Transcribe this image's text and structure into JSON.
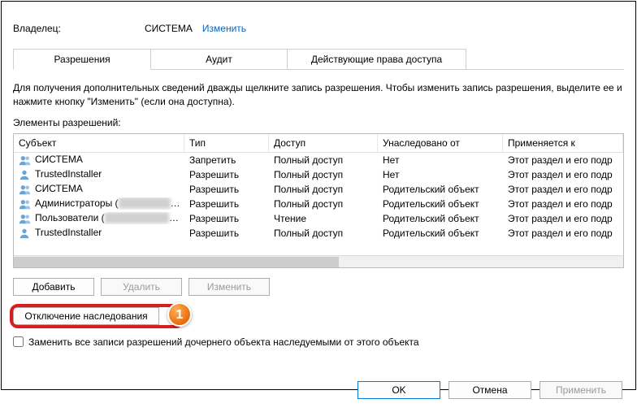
{
  "owner": {
    "label": "Владелец:",
    "value": "СИСТЕМА",
    "change_link": "Изменить"
  },
  "tabs": {
    "permissions": "Разрешения",
    "audit": "Аудит",
    "effective": "Действующие права доступа"
  },
  "info_text": "Для получения дополнительных сведений дважды щелкните запись разрешения. Чтобы изменить запись разрешения, выделите ее и нажмите кнопку \"Изменить\" (если она доступна).",
  "elements_label": "Элементы разрешений:",
  "columns": {
    "subject": "Субъект",
    "type": "Тип",
    "access": "Доступ",
    "inherited": "Унаследовано от",
    "applies": "Применяется к"
  },
  "rows": [
    {
      "icon": "users",
      "subject": "СИСТЕМА",
      "type": "Запретить",
      "access": "Полный доступ",
      "inherited": "Нет",
      "applies": "Этот раздел и его подр"
    },
    {
      "icon": "user",
      "subject": "TrustedInstaller",
      "type": "Разрешить",
      "access": "Полный доступ",
      "inherited": "Нет",
      "applies": "Этот раздел и его подр"
    },
    {
      "icon": "users",
      "subject": "СИСТЕМА",
      "type": "Разрешить",
      "access": "Полный доступ",
      "inherited": "Родительский объект",
      "applies": "Этот раздел и его подр"
    },
    {
      "icon": "users",
      "subject": "Администраторы (",
      "subject_blur": "XXXXXX-X",
      "subject_suffix": "…",
      "type": "Разрешить",
      "access": "Полный доступ",
      "inherited": "Родительский объект",
      "applies": "Этот раздел и его подр"
    },
    {
      "icon": "users",
      "subject": "Пользователи (",
      "subject_blur": "XXXXXX XXX",
      "subject_suffix": "…",
      "type": "Разрешить",
      "access": "Чтение",
      "inherited": "Родительский объект",
      "applies": "Этот раздел и его подр"
    },
    {
      "icon": "user",
      "subject": "TrustedInstaller",
      "type": "Разрешить",
      "access": "Полный доступ",
      "inherited": "Родительский объект",
      "applies": "Этот раздел и его подр"
    }
  ],
  "buttons": {
    "add": "Добавить",
    "remove": "Удалить",
    "edit": "Изменить",
    "disable_inh": "Отключение наследования",
    "ok": "OK",
    "cancel": "Отмена",
    "apply": "Применить"
  },
  "replace_checkbox": "Заменить все записи разрешений дочернего объекта наследуемыми от этого объекта",
  "annotation": {
    "step": "1"
  }
}
